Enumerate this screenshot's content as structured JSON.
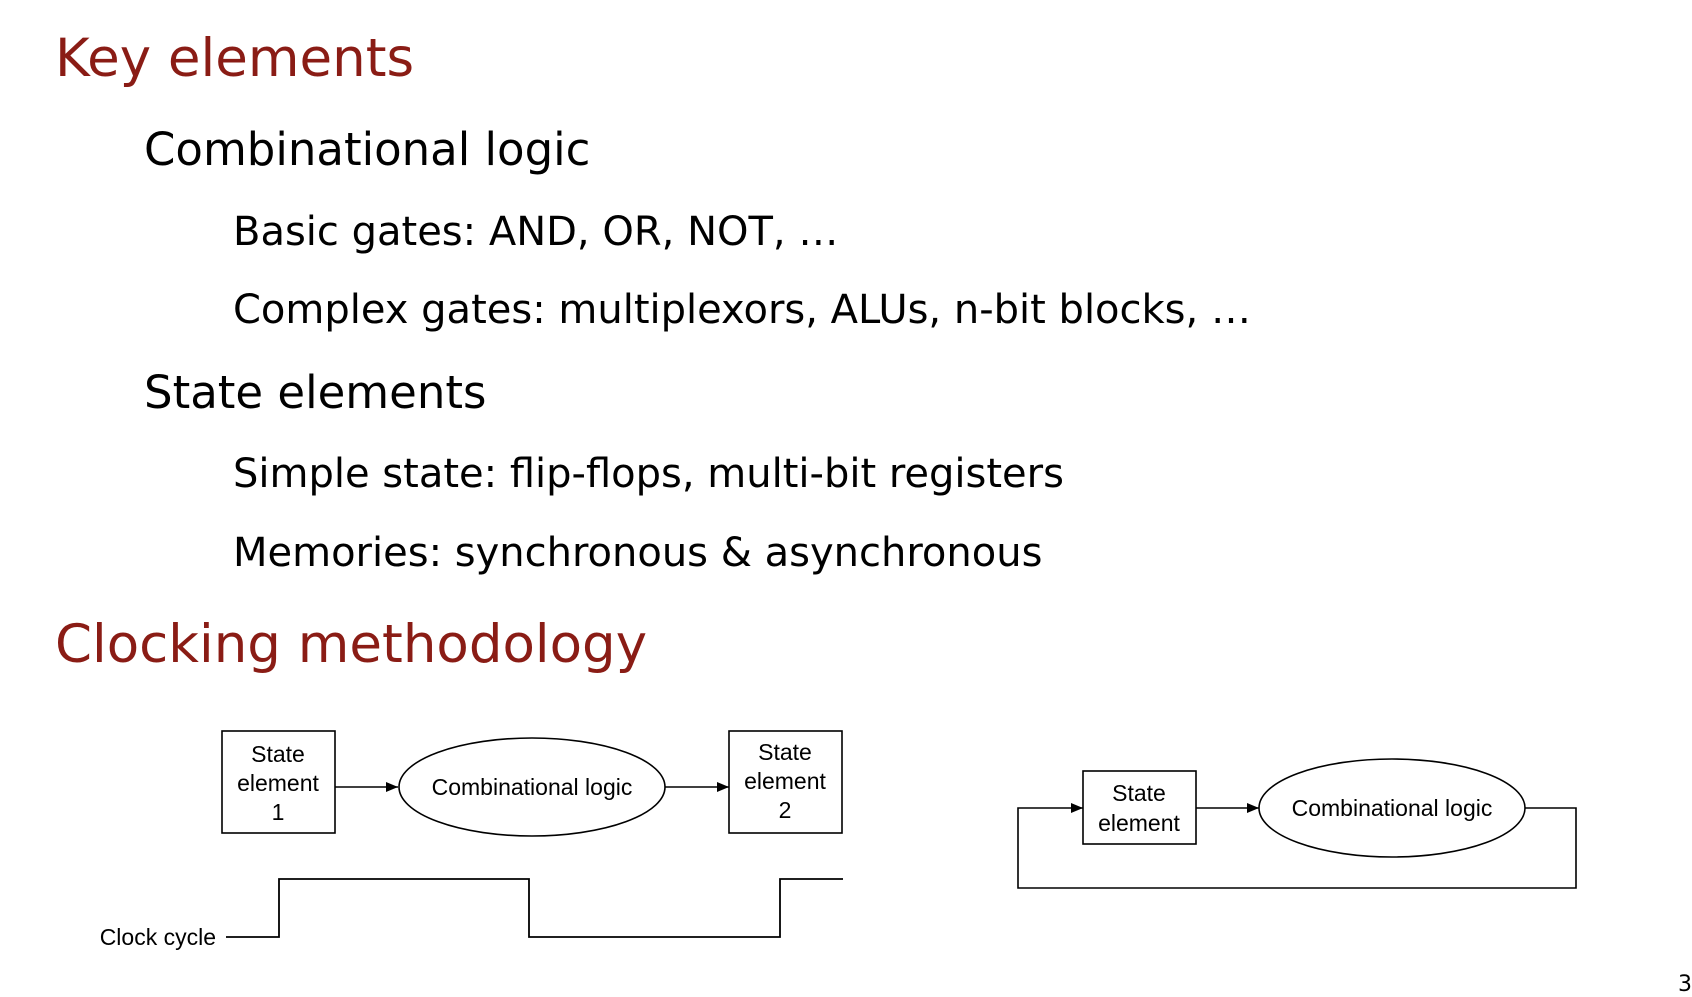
{
  "heading1": "Key elements",
  "items": [
    {
      "label": "Combinational logic",
      "subitems": [
        "Basic gates: AND, OR, NOT, …",
        "Complex gates: multiplexors, ALUs, n-bit blocks, …"
      ]
    },
    {
      "label": "State elements",
      "subitems": [
        "Simple state: flip-flops, multi-bit registers",
        "Memories: synchronous & asynchronous"
      ]
    }
  ],
  "heading2": "Clocking methodology",
  "diagram_left": {
    "state1_lines": [
      "State",
      "element",
      "1"
    ],
    "logic_label": "Combinational logic",
    "state2_lines": [
      "State",
      "element",
      "2"
    ],
    "clock_label": "Clock cycle"
  },
  "diagram_right": {
    "state_lines": [
      "State",
      "element"
    ],
    "logic_label": "Combinational logic"
  },
  "colors": {
    "heading": "#8a1c15",
    "body": "#000000"
  },
  "page_number": "3"
}
